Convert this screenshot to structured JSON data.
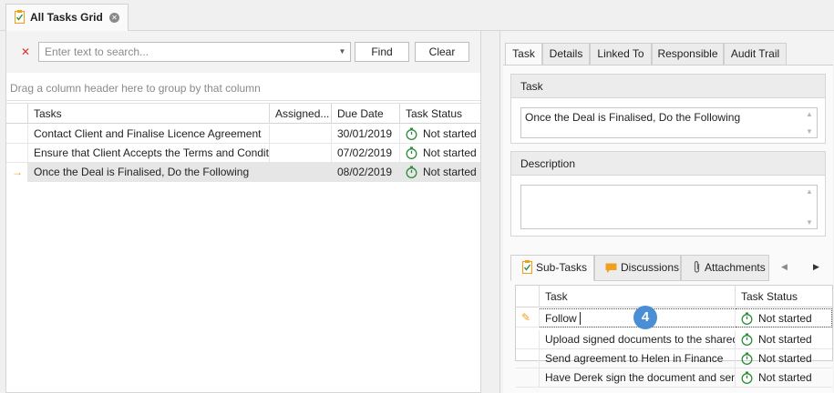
{
  "doc_tab": {
    "title": "All Tasks Grid"
  },
  "search": {
    "placeholder": "Enter text to search...",
    "find_label": "Find",
    "clear_label": "Clear"
  },
  "group_panel": {
    "text": "Drag a column header here to group by that column"
  },
  "grid": {
    "columns": [
      "Tasks",
      "Assigned...",
      "Due Date",
      "Task Status"
    ],
    "rows": [
      {
        "task": "Contact Client and Finalise Licence Agreement",
        "assigned": "",
        "due": "30/01/2019",
        "status": "Not started"
      },
      {
        "task": "Ensure that Client Accepts the Terms and Conditions",
        "assigned": "",
        "due": "07/02/2019",
        "status": "Not started"
      },
      {
        "task": "Once the Deal is Finalised, Do the Following",
        "assigned": "",
        "due": "08/02/2019",
        "status": "Not started"
      }
    ],
    "focused_row_index": 2
  },
  "detail_tabs": [
    "Task",
    "Details",
    "Linked To",
    "Responsible",
    "Audit Trail"
  ],
  "active_detail_tab": "Task",
  "task_group": {
    "label": "Task",
    "value": "Once the Deal is Finalised, Do the Following"
  },
  "description_group": {
    "label": "Description",
    "value": ""
  },
  "sub_tabs": [
    "Sub-Tasks",
    "Discussions",
    "Attachments"
  ],
  "active_sub_tab": "Sub-Tasks",
  "subgrid": {
    "columns": [
      "Task",
      "Task Status"
    ],
    "rows": [
      {
        "task": "Follow",
        "status": "Not started",
        "editing": true
      },
      {
        "task": "Upload signed documents to the shared ...",
        "status": "Not started"
      },
      {
        "task": "Send agreement to Helen in Finance",
        "status": "Not started"
      },
      {
        "task": "Have Derek sign the document and send...",
        "status": "Not started"
      }
    ]
  },
  "callout_badge": "4",
  "colors": {
    "accent_orange": "#f0a020",
    "clear_red": "#e03030",
    "status_green": "#2e8b3a",
    "badge_blue": "#4a8fd6"
  },
  "icons": {
    "doc_tab": "clipboard-check-icon",
    "status": "stopwatch-icon",
    "sub_tasks": "clipboard-check-icon",
    "discussions": "chat-bubble-icon",
    "attachments": "paperclip-icon",
    "row_focus": "arrow-right-icon",
    "row_edit": "pencil-icon"
  }
}
